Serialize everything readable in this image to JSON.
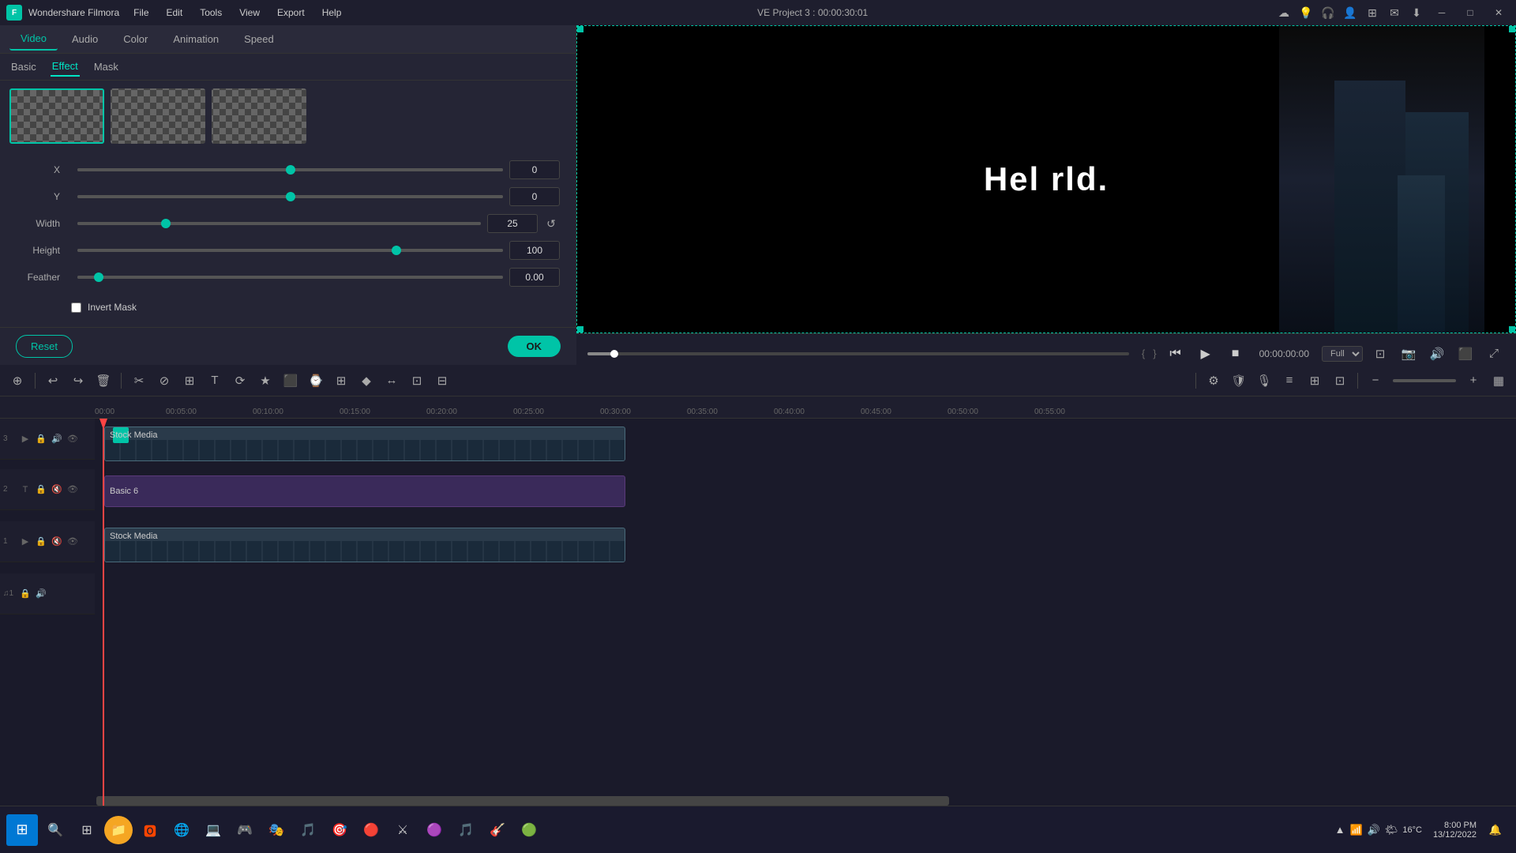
{
  "app": {
    "name": "Wondershare Filmora",
    "logo": "F",
    "title": "VE Project 3 : 00:00:30:01"
  },
  "menu": {
    "items": [
      "File",
      "Edit",
      "Tools",
      "View",
      "Export",
      "Help"
    ]
  },
  "window_controls": {
    "minimize": "─",
    "maximize": "□",
    "close": "✕"
  },
  "prop_tabs": {
    "items": [
      "Video",
      "Audio",
      "Color",
      "Animation",
      "Speed"
    ],
    "active": "Video"
  },
  "sub_tabs": {
    "items": [
      "Basic",
      "Effect",
      "Mask"
    ],
    "active": "Effect"
  },
  "thumbnails": [
    {
      "id": 1,
      "selected": true
    },
    {
      "id": 2,
      "selected": false
    },
    {
      "id": 3,
      "selected": false
    }
  ],
  "controls": {
    "x": {
      "label": "X",
      "value": "0",
      "thumb_pct": 50
    },
    "y": {
      "label": "Y",
      "value": "0",
      "thumb_pct": 50
    },
    "width": {
      "label": "Width",
      "value": "25",
      "thumb_pct": 22
    },
    "height": {
      "label": "Height",
      "value": "100",
      "thumb_pct": 75
    },
    "feather": {
      "label": "Feather",
      "value": "0.00",
      "thumb_pct": 5
    }
  },
  "invert_mask": {
    "label": "Invert Mask",
    "checked": false
  },
  "footer": {
    "reset": "Reset",
    "ok": "OK"
  },
  "preview": {
    "text": "Hel   rld.",
    "timecode_start": "{",
    "timecode_end": "}",
    "time": "00:00:00:00",
    "quality": "Full"
  },
  "playback": {
    "rewind": "⏮",
    "play": "▶",
    "stop": "■",
    "progress": 5
  },
  "toolbar_left": [
    "↩",
    "↪",
    "🗑",
    "✂",
    "⊘",
    "+",
    "T",
    "⟳",
    "★",
    "⬛",
    "⌚",
    "⊞",
    "◆",
    "↔",
    "⊡",
    "⊟"
  ],
  "toolbar_right": [
    "⚙",
    "🛡",
    "🎙",
    "≡",
    "⊞",
    "⊡",
    "−",
    "━━━━",
    "+",
    "▦"
  ],
  "timeline": {
    "ruler_labels": [
      "00:00",
      "00:05:00",
      "00:10:00",
      "00:15:00",
      "00:20:00",
      "00:25:00",
      "00:30:00",
      "00:35:00",
      "00:40:00",
      "00:45:00",
      "00:50:00",
      "00:55:00"
    ],
    "tracks": [
      {
        "num": "3",
        "label": "Stock Media",
        "type": "video",
        "color": "#2a3a4a"
      },
      {
        "num": "2",
        "label": "Basic 6",
        "type": "text",
        "color": "#3a2a5a"
      },
      {
        "num": "1",
        "label": "Stock Media",
        "type": "video",
        "color": "#2a3a4a"
      }
    ]
  },
  "taskbar": {
    "clock": "8:00 PM",
    "date": "13/12/2022",
    "temp": "16°C",
    "icons": [
      "🔍",
      "⊞",
      "🟠",
      "🌐",
      "💻",
      "🎮",
      "🎭",
      "🎵",
      "🎯",
      "🔴",
      "🟢",
      "🎵"
    ]
  }
}
